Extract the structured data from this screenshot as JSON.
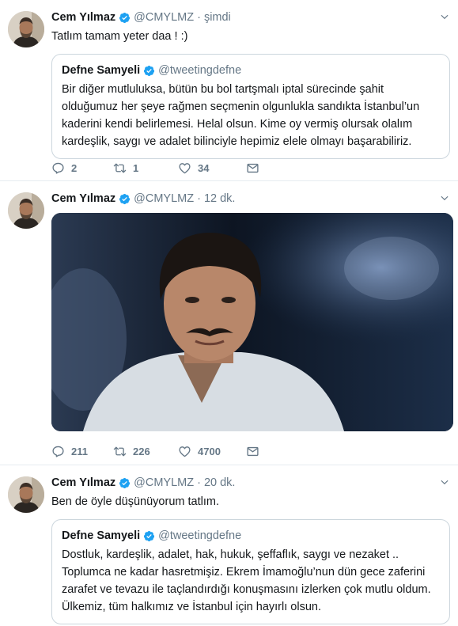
{
  "colors": {
    "accent": "#1da1f2",
    "text": "#14171a",
    "muted": "#657786",
    "border": "#ccd6dd"
  },
  "tweets": [
    {
      "name": "Cem Yılmaz",
      "handle": "@CMYLMZ",
      "separator": "·",
      "time": "şimdi",
      "text": "Tatlım tamam yeter daa ! :)",
      "quote": {
        "name": "Defne Samyeli",
        "handle": "@tweetingdefne",
        "text": "Bir diğer mutluluksa, bütün bu bol tartşmalı iptal sürecinde şahit olduğumuz her şeye rağmen seçmenin olgunlukla sandıkta İstanbul’un kaderini kendi belirlemesi. Helal olsun. Kime oy vermiş olursak olalım kardeşlik, saygı ve adalet bilinciyle hepimiz elele olmayı başarabiliriz."
      },
      "replies": "2",
      "retweets": "1",
      "likes": "34"
    },
    {
      "name": "Cem Yılmaz",
      "handle": "@CMYLMZ",
      "separator": "·",
      "time": "12 dk.",
      "media_icon": "photo",
      "replies": "211",
      "retweets": "226",
      "likes": "4700"
    },
    {
      "name": "Cem Yılmaz",
      "handle": "@CMYLMZ",
      "separator": "·",
      "time": "20 dk.",
      "text": "Ben de öyle düşünüyorum tatlım.",
      "quote": {
        "name": "Defne Samyeli",
        "handle": "@tweetingdefne",
        "text": "Dostluk, kardeşlik, adalet, hak, hukuk, şeffaflık, saygı ve nezaket .. Toplumca ne kadar hasretmişiz. Ekrem İmamoğlu’nun dün gece zaferini zarafet ve tevazu ile taçlandırdığı konuşmasını izlerken çok mutlu oldum. Ülkemiz, tüm halkımız ve İstanbul için hayırlı olsun."
      }
    }
  ]
}
